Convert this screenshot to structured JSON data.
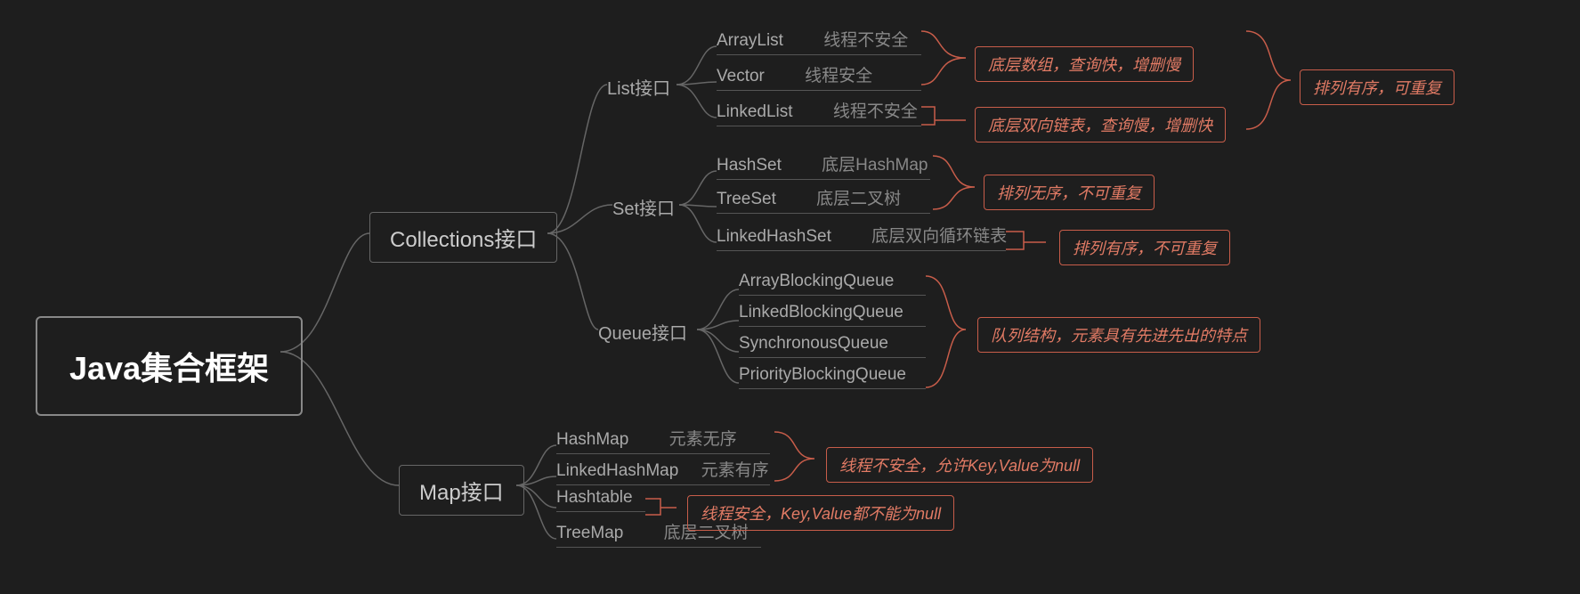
{
  "root": {
    "title": "Java集合框架"
  },
  "collections": {
    "label": "Collections接口",
    "list": {
      "label": "List接口",
      "items": [
        {
          "name": "ArrayList",
          "detail": "线程不安全"
        },
        {
          "name": "Vector",
          "detail": "线程安全"
        },
        {
          "name": "LinkedList",
          "detail": "线程不安全"
        }
      ],
      "note1": "底层数组，查询快，增删慢",
      "note2": "底层双向链表，查询慢，增删快",
      "note_overall": "排列有序，可重复"
    },
    "set": {
      "label": "Set接口",
      "items": [
        {
          "name": "HashSet",
          "detail": "底层HashMap"
        },
        {
          "name": "TreeSet",
          "detail": "底层二叉树"
        },
        {
          "name": "LinkedHashSet",
          "detail": "底层双向循环链表"
        }
      ],
      "note1": "排列无序，不可重复",
      "note2": "排列有序，不可重复"
    },
    "queue": {
      "label": "Queue接口",
      "items": [
        {
          "name": "ArrayBlockingQueue",
          "detail": ""
        },
        {
          "name": "LinkedBlockingQueue",
          "detail": ""
        },
        {
          "name": "SynchronousQueue",
          "detail": ""
        },
        {
          "name": "PriorityBlockingQueue",
          "detail": ""
        }
      ],
      "note": "队列结构，元素具有先进先出的特点"
    }
  },
  "map": {
    "label": "Map接口",
    "items": [
      {
        "name": "HashMap",
        "detail": "元素无序"
      },
      {
        "name": "LinkedHashMap",
        "detail": "元素有序"
      },
      {
        "name": "Hashtable",
        "detail": ""
      },
      {
        "name": "TreeMap",
        "detail": "底层二叉树"
      }
    ],
    "note1": "线程不安全，允许Key,Value为null",
    "note2": "线程安全，Key,Value都不能为null"
  }
}
